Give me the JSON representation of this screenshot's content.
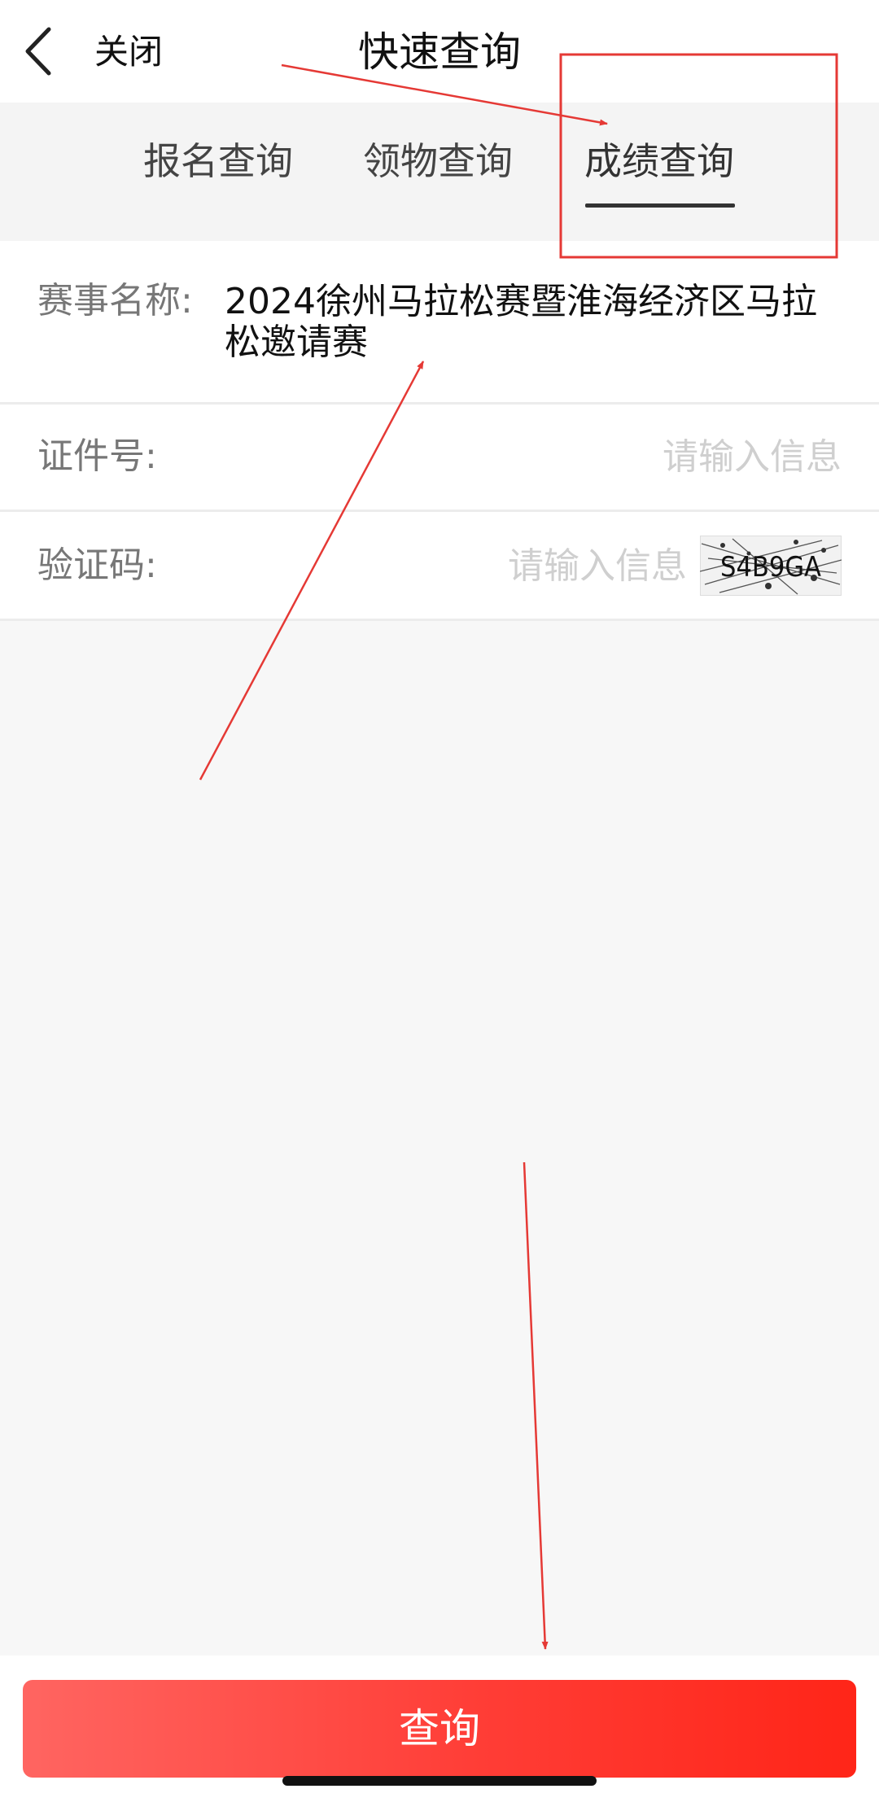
{
  "nav": {
    "back_icon": "chevron-left-icon",
    "close_label": "关闭",
    "title": "快速查询"
  },
  "tabs": [
    {
      "label": "报名查询",
      "active": false
    },
    {
      "label": "领物查询",
      "active": false
    },
    {
      "label": "成绩查询",
      "active": true
    }
  ],
  "form": {
    "event": {
      "label": "赛事名称:",
      "value": "2024徐州马拉松赛暨淮海经济区马拉松邀请赛"
    },
    "id_number": {
      "label": "证件号:",
      "value": "",
      "placeholder": "请输入信息"
    },
    "captcha": {
      "label": "验证码:",
      "value": "",
      "placeholder": "请输入信息",
      "image_text": "S4B9GA"
    }
  },
  "query_button": {
    "label": "查询"
  },
  "colors": {
    "accent": "#ff3b30",
    "annotation": "#e53935",
    "page_bg": "#f7f7f7"
  }
}
